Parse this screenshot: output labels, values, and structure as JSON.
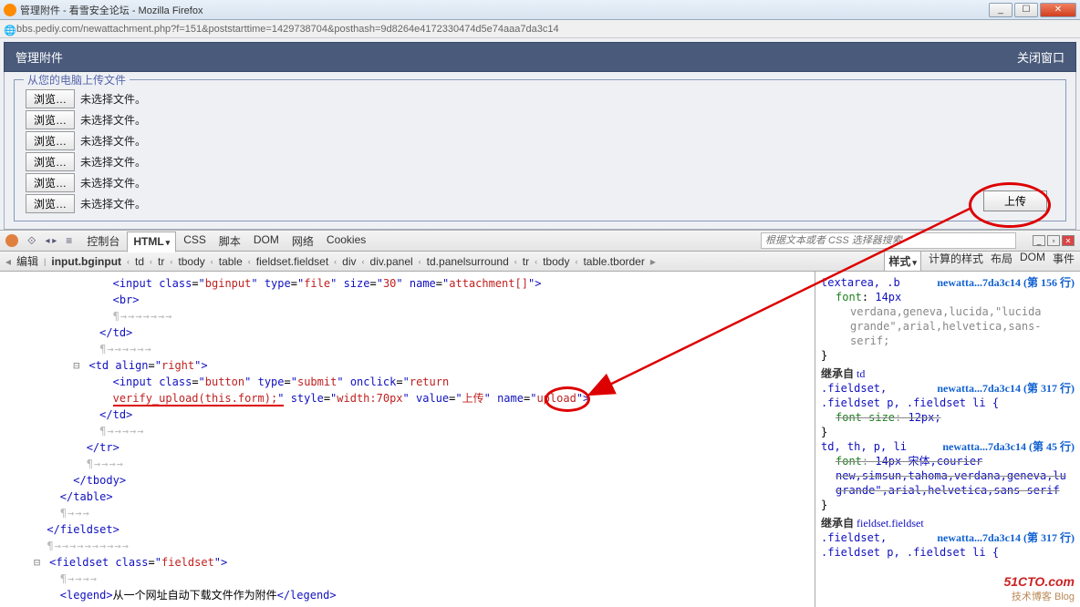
{
  "window": {
    "title": "管理附件 - 看雪安全论坛 - Mozilla Firefox"
  },
  "url": "bbs.pediy.com/newattachment.php?f=151&poststarttime=1429738704&posthash=9d8264e4172330474d5e74aaa7da3c14",
  "panel": {
    "title": "管理附件",
    "close": "关闭窗口"
  },
  "fieldset": {
    "legend": "从您的电脑上传文件",
    "browse": "浏览…",
    "nofile": "未选择文件。",
    "rows": 6,
    "submit": "上传"
  },
  "firebug": {
    "tabs": [
      "控制台",
      "HTML",
      "CSS",
      "脚本",
      "DOM",
      "网络",
      "Cookies"
    ],
    "active_tab": "HTML",
    "search_placeholder": "根据文本或者 CSS 选择器搜索",
    "edit": "编辑",
    "crumbs": [
      "input.bginput",
      "td",
      "tr",
      "tbody",
      "table",
      "fieldset.fieldset",
      "div",
      "div.panel",
      "td.panelsurround",
      "tr",
      "tbody",
      "table.tborder"
    ],
    "side_tabs": [
      "样式",
      "计算的样式",
      "布局",
      "DOM",
      "事件"
    ],
    "side_active": "样式"
  },
  "html_src": {
    "l1": "<input class=\"bginput\" type=\"file\" size=\"30\" name=\"attachment[]\">",
    "l2": "<br>",
    "l3": "</td>",
    "l4": "<td align=\"right\">",
    "l5a": "<input class=\"button\" type=\"submit\" onclick=\"return ",
    "l5b": "verify_upload(this.form);\"",
    "l5c": " style=\"width:70px\" value=",
    "l5d": "\"上传\"",
    "l5e": " name=\"upload\">",
    "l6": "</td>",
    "l7": "</tr>",
    "l8": "</tbody>",
    "l9": "</table>",
    "l10": "</fieldset>",
    "l11": "<fieldset class=\"fieldset\">",
    "l12a": "<legend>",
    "l12b": "从一个网址自动下载文件作为附件",
    "l12c": "</legend>"
  },
  "css_panel": {
    "rule1_sel": "textarea, .b",
    "rule1_link": "newatta...7da3c14 (第 156 行)",
    "rule1_prop": "font",
    "rule1_val": "14px",
    "rule1_val2": "verdana,geneva,lucida,\"lucida grande\",arial,helvetica,sans-serif;",
    "inh1": "继承自",
    "inh1_tag": "td",
    "rule2_sel": ".fieldset,",
    "rule2_link": "newatta...7da3c14 (第 317 行)",
    "rule2_b": ".fieldset p, .fieldset li {",
    "rule2_prop": "font-size",
    "rule2_val": "12px;",
    "rule3_sel": "td, th, p, li",
    "rule3_link": "newatta...7da3c14 (第 45 行)",
    "rule3_prop": "font",
    "rule3_val": "14px 宋体,courier new,simsun,tahoma,verdana,geneva,lu grande\",arial,helvetica,sans-serif",
    "inh2": "继承自",
    "inh2_tag": "fieldset.fieldset",
    "rule4_sel": ".fieldset,",
    "rule4_link": "newatta...7da3c14 (第 317 行)",
    "rule4_b": ".fieldset p, .fieldset li {"
  },
  "watermark": {
    "brand": "51CTO.com",
    "sub": "技术博客  Blog"
  }
}
